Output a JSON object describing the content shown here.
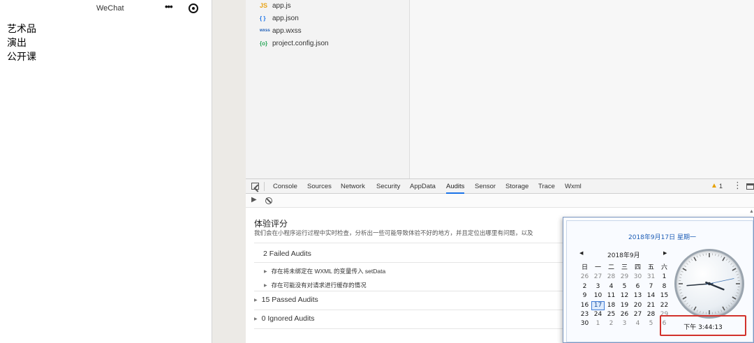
{
  "simulator": {
    "title": "WeChat",
    "more": "•••",
    "items": [
      "艺术品",
      "演出",
      "公开课"
    ]
  },
  "files": [
    {
      "icon": "JS",
      "name": "app.js",
      "color": "#e8a317"
    },
    {
      "icon": "{ }",
      "name": "app.json",
      "color": "#1a73e8"
    },
    {
      "icon": "wxss",
      "name": "app.wxss",
      "color": "#1a5bb5"
    },
    {
      "icon": "{o}",
      "name": "project.config.json",
      "color": "#2aa75a"
    }
  ],
  "devtools": {
    "tabs": [
      "Console",
      "Sources",
      "Network",
      "Security",
      "AppData",
      "Audits",
      "Sensor",
      "Storage",
      "Trace",
      "Wxml"
    ],
    "active_tab": "Audits",
    "warning_count": "1",
    "colors": {
      "accent": "#1a73e8",
      "warning": "#e6a100"
    }
  },
  "audits": {
    "title": "体验评分",
    "description": "我们会在小程序运行过程中实时检查，分析出一些可能导致体验不好的地方，并且定位出哪里有问题，以及",
    "failed": {
      "label": "2 Failed Audits",
      "items": [
        "存在将未绑定在 WXML 的变量传入 setData",
        "存在可能没有对请求进行缓存的情况"
      ]
    },
    "passed": "15 Passed Audits",
    "ignored": "0 Ignored Audits"
  },
  "calendar": {
    "date_header": "2018年9月17日 星期一",
    "month": "2018年9月",
    "weekdays": [
      "日",
      "一",
      "二",
      "三",
      "四",
      "五",
      "六"
    ],
    "weeks": [
      [
        {
          "d": "26",
          "dim": true
        },
        {
          "d": "27",
          "dim": true
        },
        {
          "d": "28",
          "dim": true
        },
        {
          "d": "29",
          "dim": true
        },
        {
          "d": "30",
          "dim": true
        },
        {
          "d": "31",
          "dim": true
        },
        {
          "d": "1"
        }
      ],
      [
        {
          "d": "2"
        },
        {
          "d": "3"
        },
        {
          "d": "4"
        },
        {
          "d": "5"
        },
        {
          "d": "6"
        },
        {
          "d": "7"
        },
        {
          "d": "8"
        }
      ],
      [
        {
          "d": "9"
        },
        {
          "d": "10"
        },
        {
          "d": "11"
        },
        {
          "d": "12"
        },
        {
          "d": "13"
        },
        {
          "d": "14"
        },
        {
          "d": "15"
        }
      ],
      [
        {
          "d": "16"
        },
        {
          "d": "17",
          "today": true
        },
        {
          "d": "18"
        },
        {
          "d": "19"
        },
        {
          "d": "20"
        },
        {
          "d": "21"
        },
        {
          "d": "22"
        }
      ],
      [
        {
          "d": "23"
        },
        {
          "d": "24"
        },
        {
          "d": "25"
        },
        {
          "d": "26"
        },
        {
          "d": "27"
        },
        {
          "d": "28"
        },
        {
          "d": "29",
          "dim": true
        }
      ],
      [
        {
          "d": "30"
        },
        {
          "d": "1",
          "dim": true
        },
        {
          "d": "2",
          "dim": true
        },
        {
          "d": "3",
          "dim": true
        },
        {
          "d": "4",
          "dim": true
        },
        {
          "d": "5",
          "dim": true
        },
        {
          "d": "6",
          "dim": true
        }
      ]
    ],
    "time": "下午 3:44:13",
    "clock": {
      "hours": 3,
      "minutes": 44,
      "seconds": 13
    },
    "colors": {
      "highlight_box": "#d2312b",
      "date_text": "#1a5bb5"
    }
  }
}
